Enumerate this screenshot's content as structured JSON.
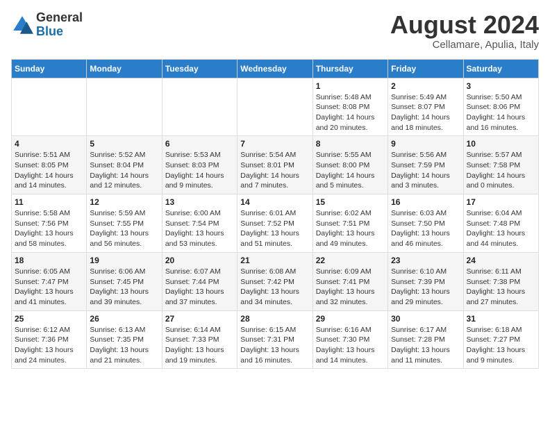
{
  "logo": {
    "general": "General",
    "blue": "Blue"
  },
  "title": "August 2024",
  "subtitle": "Cellamare, Apulia, Italy",
  "headers": [
    "Sunday",
    "Monday",
    "Tuesday",
    "Wednesday",
    "Thursday",
    "Friday",
    "Saturday"
  ],
  "weeks": [
    [
      {
        "day": "",
        "info": ""
      },
      {
        "day": "",
        "info": ""
      },
      {
        "day": "",
        "info": ""
      },
      {
        "day": "",
        "info": ""
      },
      {
        "day": "1",
        "info": "Sunrise: 5:48 AM\nSunset: 8:08 PM\nDaylight: 14 hours\nand 20 minutes."
      },
      {
        "day": "2",
        "info": "Sunrise: 5:49 AM\nSunset: 8:07 PM\nDaylight: 14 hours\nand 18 minutes."
      },
      {
        "day": "3",
        "info": "Sunrise: 5:50 AM\nSunset: 8:06 PM\nDaylight: 14 hours\nand 16 minutes."
      }
    ],
    [
      {
        "day": "4",
        "info": "Sunrise: 5:51 AM\nSunset: 8:05 PM\nDaylight: 14 hours\nand 14 minutes."
      },
      {
        "day": "5",
        "info": "Sunrise: 5:52 AM\nSunset: 8:04 PM\nDaylight: 14 hours\nand 12 minutes."
      },
      {
        "day": "6",
        "info": "Sunrise: 5:53 AM\nSunset: 8:03 PM\nDaylight: 14 hours\nand 9 minutes."
      },
      {
        "day": "7",
        "info": "Sunrise: 5:54 AM\nSunset: 8:01 PM\nDaylight: 14 hours\nand 7 minutes."
      },
      {
        "day": "8",
        "info": "Sunrise: 5:55 AM\nSunset: 8:00 PM\nDaylight: 14 hours\nand 5 minutes."
      },
      {
        "day": "9",
        "info": "Sunrise: 5:56 AM\nSunset: 7:59 PM\nDaylight: 14 hours\nand 3 minutes."
      },
      {
        "day": "10",
        "info": "Sunrise: 5:57 AM\nSunset: 7:58 PM\nDaylight: 14 hours\nand 0 minutes."
      }
    ],
    [
      {
        "day": "11",
        "info": "Sunrise: 5:58 AM\nSunset: 7:56 PM\nDaylight: 13 hours\nand 58 minutes."
      },
      {
        "day": "12",
        "info": "Sunrise: 5:59 AM\nSunset: 7:55 PM\nDaylight: 13 hours\nand 56 minutes."
      },
      {
        "day": "13",
        "info": "Sunrise: 6:00 AM\nSunset: 7:54 PM\nDaylight: 13 hours\nand 53 minutes."
      },
      {
        "day": "14",
        "info": "Sunrise: 6:01 AM\nSunset: 7:52 PM\nDaylight: 13 hours\nand 51 minutes."
      },
      {
        "day": "15",
        "info": "Sunrise: 6:02 AM\nSunset: 7:51 PM\nDaylight: 13 hours\nand 49 minutes."
      },
      {
        "day": "16",
        "info": "Sunrise: 6:03 AM\nSunset: 7:50 PM\nDaylight: 13 hours\nand 46 minutes."
      },
      {
        "day": "17",
        "info": "Sunrise: 6:04 AM\nSunset: 7:48 PM\nDaylight: 13 hours\nand 44 minutes."
      }
    ],
    [
      {
        "day": "18",
        "info": "Sunrise: 6:05 AM\nSunset: 7:47 PM\nDaylight: 13 hours\nand 41 minutes."
      },
      {
        "day": "19",
        "info": "Sunrise: 6:06 AM\nSunset: 7:45 PM\nDaylight: 13 hours\nand 39 minutes."
      },
      {
        "day": "20",
        "info": "Sunrise: 6:07 AM\nSunset: 7:44 PM\nDaylight: 13 hours\nand 37 minutes."
      },
      {
        "day": "21",
        "info": "Sunrise: 6:08 AM\nSunset: 7:42 PM\nDaylight: 13 hours\nand 34 minutes."
      },
      {
        "day": "22",
        "info": "Sunrise: 6:09 AM\nSunset: 7:41 PM\nDaylight: 13 hours\nand 32 minutes."
      },
      {
        "day": "23",
        "info": "Sunrise: 6:10 AM\nSunset: 7:39 PM\nDaylight: 13 hours\nand 29 minutes."
      },
      {
        "day": "24",
        "info": "Sunrise: 6:11 AM\nSunset: 7:38 PM\nDaylight: 13 hours\nand 27 minutes."
      }
    ],
    [
      {
        "day": "25",
        "info": "Sunrise: 6:12 AM\nSunset: 7:36 PM\nDaylight: 13 hours\nand 24 minutes."
      },
      {
        "day": "26",
        "info": "Sunrise: 6:13 AM\nSunset: 7:35 PM\nDaylight: 13 hours\nand 21 minutes."
      },
      {
        "day": "27",
        "info": "Sunrise: 6:14 AM\nSunset: 7:33 PM\nDaylight: 13 hours\nand 19 minutes."
      },
      {
        "day": "28",
        "info": "Sunrise: 6:15 AM\nSunset: 7:31 PM\nDaylight: 13 hours\nand 16 minutes."
      },
      {
        "day": "29",
        "info": "Sunrise: 6:16 AM\nSunset: 7:30 PM\nDaylight: 13 hours\nand 14 minutes."
      },
      {
        "day": "30",
        "info": "Sunrise: 6:17 AM\nSunset: 7:28 PM\nDaylight: 13 hours\nand 11 minutes."
      },
      {
        "day": "31",
        "info": "Sunrise: 6:18 AM\nSunset: 7:27 PM\nDaylight: 13 hours\nand 9 minutes."
      }
    ]
  ]
}
